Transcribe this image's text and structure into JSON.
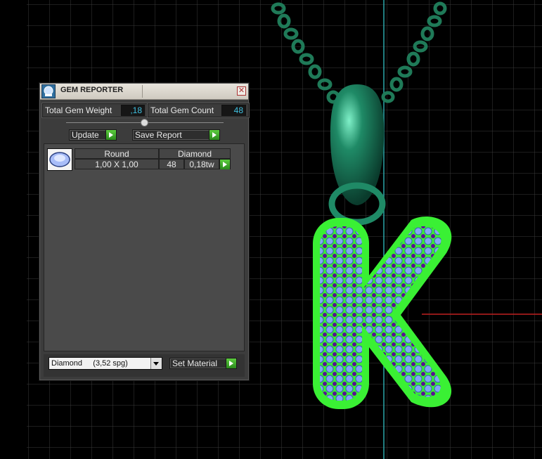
{
  "panel": {
    "title": "GEM REPORTER",
    "close_glyph": "✕",
    "stats": {
      "weight_label": "Total Gem Weight",
      "weight_value": ",18",
      "count_label": "Total Gem Count",
      "count_value": "48"
    },
    "buttons": {
      "update": "Update",
      "save_report": "Save Report",
      "set_material": "Set Material"
    },
    "gem_rows": [
      {
        "shape": "Round",
        "size": "1,00 X 1,00",
        "material": "Diamond",
        "count": "48",
        "weight": "0,18tw"
      }
    ],
    "material_select": {
      "value": "Diamond     (3,52 spg)"
    }
  },
  "colors": {
    "metal_green": "#1f8a66",
    "highlight_green": "#3af034",
    "gem_blue": "#7da7f0",
    "gem_purple": "#6a1aa0",
    "axis_cyan": "#2aa6a8",
    "axis_red": "#c02020"
  },
  "icons": {
    "title_icon": "gem-reporter-icon",
    "close": "close-icon",
    "go": "green-arrow-icon",
    "thumb": "round-gem-icon",
    "dropdown": "chevron-down-icon"
  }
}
